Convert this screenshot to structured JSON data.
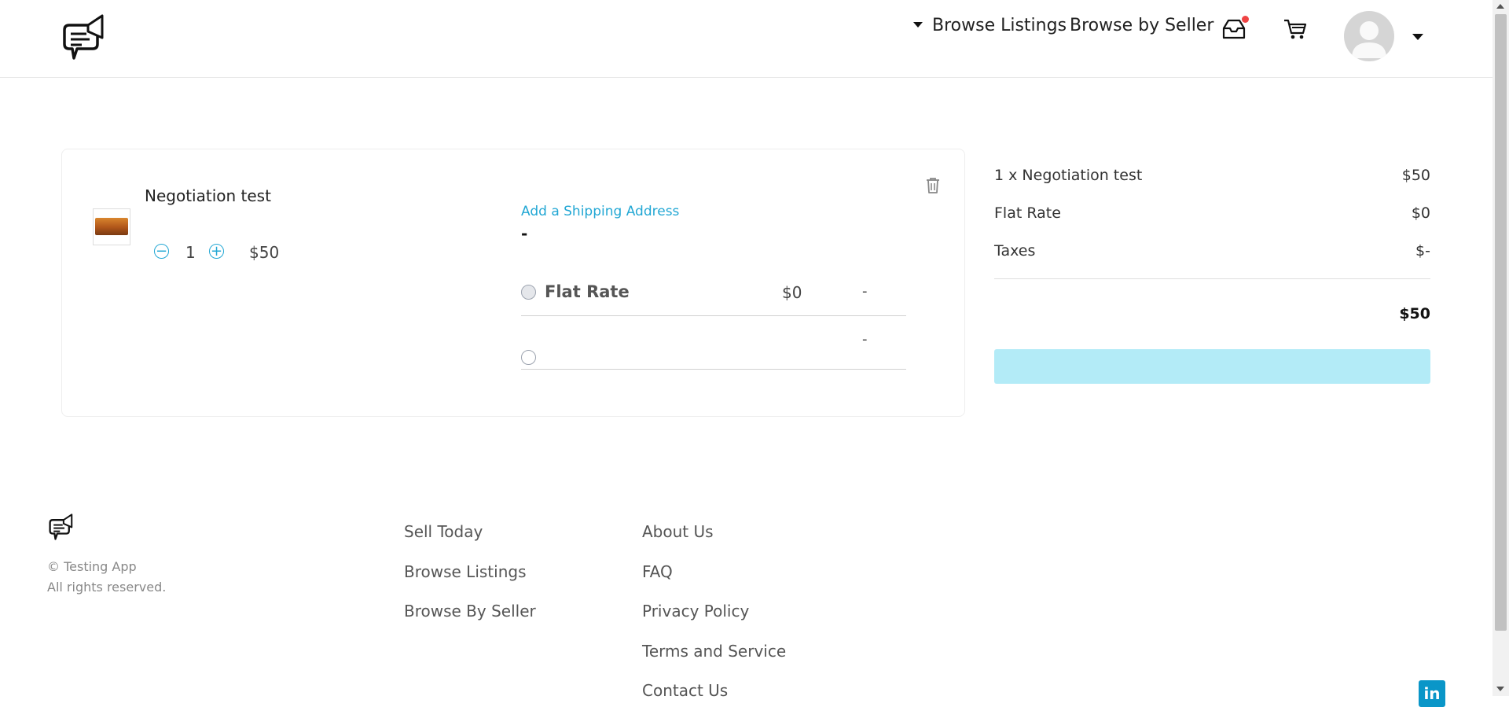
{
  "header": {
    "nav": {
      "browse_listings": "Browse Listings",
      "browse_by_seller": "Browse by Seller"
    },
    "icons": {
      "logo": "megaphone-chat-logo",
      "inbox": "inbox-icon",
      "cart": "cart-icon",
      "avatar": "user-avatar",
      "user_menu": "chevron-down-icon"
    },
    "notification_color": "#ef4444"
  },
  "cart_item": {
    "name": "Negotiation test",
    "quantity": "1",
    "price": "$50",
    "qty_minus": "−",
    "qty_plus": "+",
    "shipping": {
      "add_address_link": "Add a Shipping Address",
      "address_value": "-",
      "options": [
        {
          "label": "Flat Rate",
          "price": "$0",
          "eta": "-"
        },
        {
          "label": "",
          "price": "",
          "eta": "-"
        }
      ]
    }
  },
  "summary": {
    "rows": [
      {
        "label": "1 x Negotiation test",
        "value": "$50"
      },
      {
        "label": "Flat Rate",
        "value": "$0"
      },
      {
        "label": "Taxes",
        "value": "$-"
      }
    ],
    "total": "$50",
    "checkout_button_color": "#b3ebf7"
  },
  "footer": {
    "copyright": "© Testing App",
    "rights": "All rights reserved.",
    "col1": [
      "Sell Today",
      "Browse Listings",
      "Browse By Seller"
    ],
    "col2": [
      "About Us",
      "FAQ",
      "Privacy Policy",
      "Terms and Service",
      "Contact Us"
    ],
    "social": "in"
  },
  "colors": {
    "accent": "#22a7d4",
    "linkedin": "#0a96c8"
  }
}
